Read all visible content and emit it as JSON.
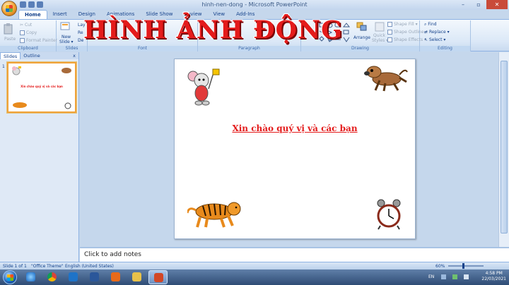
{
  "window": {
    "title": "hinh-nen-dong - Microsoft PowerPoint"
  },
  "window_controls": {
    "minimize": "–",
    "maximize": "▫",
    "close": "✕"
  },
  "tabs": [
    {
      "label": "Home",
      "active": true
    },
    {
      "label": "Insert"
    },
    {
      "label": "Design"
    },
    {
      "label": "Animations"
    },
    {
      "label": "Slide Show"
    },
    {
      "label": "Review"
    },
    {
      "label": "View"
    },
    {
      "label": "Add-Ins"
    }
  ],
  "ribbon": {
    "clipboard": {
      "label": "Clipboard",
      "paste": "Paste",
      "cut": "Cut",
      "copy": "Copy",
      "format_painter": "Format Painter"
    },
    "slides": {
      "label": "Slides",
      "new_slide": "New",
      "new_slide2": "Slide ▾",
      "layout": "Lay",
      "reset": "Re",
      "delete": "De"
    },
    "font": {
      "label": "Font"
    },
    "paragraph": {
      "label": "Paragraph"
    },
    "drawing": {
      "label": "Drawing",
      "arrange": "Arrange",
      "quick_styles": "Quick",
      "quick_styles2": "Styles ▾",
      "shape_fill": "Shape Fill ▾",
      "shape_outline": "Shape Outline ▾",
      "shape_effects": "Shape Effects ▾"
    },
    "editing": {
      "label": "Editing",
      "find": "Find",
      "replace": "Replace ▾",
      "select": "Select ▾"
    }
  },
  "banner": {
    "text": "HÌNH ẢNH ĐỘNG"
  },
  "left_pane": {
    "tabs": [
      {
        "label": "Slides",
        "active": true
      },
      {
        "label": "Outline"
      }
    ],
    "close": "x",
    "slide_number": "1",
    "thumb_text": "Xin chào quý vị và các bạn"
  },
  "slide": {
    "text": "Xin chào quý vị và các bạn",
    "images": [
      "mouse-with-flag",
      "running-dog",
      "tiger",
      "alarm-clock"
    ]
  },
  "notes": {
    "placeholder": "Click to add notes"
  },
  "status": {
    "slide": "Slide 1 of 1",
    "theme": "\"Office Theme\"",
    "language": "English (United States)",
    "zoom": "60%"
  },
  "taskbar": {
    "language": "EN",
    "time": "4:58 PM",
    "date": "22/03/2021",
    "apps": [
      "internet-explorer",
      "chrome",
      "edge",
      "word",
      "media-player",
      "file-explorer",
      "powerpoint"
    ]
  },
  "colors": {
    "accent": "#e41b1b",
    "ribbon": "#dbe8f7",
    "selection": "#f0a33a"
  }
}
